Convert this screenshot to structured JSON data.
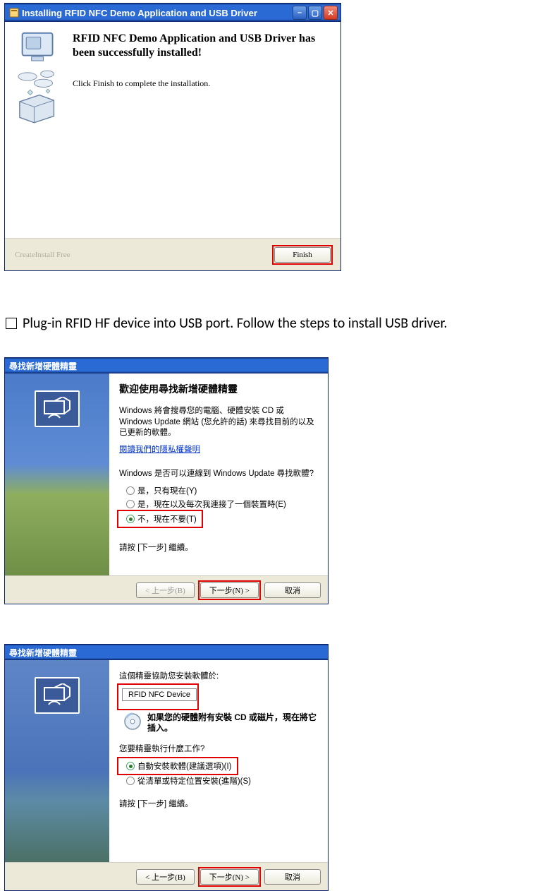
{
  "dialog1": {
    "title": "Installing RFID NFC Demo Application and USB Driver",
    "heading": "RFID NFC Demo Application and USB Driver has been successfully installed!",
    "subtext": "Click Finish to complete the installation.",
    "createinstall": "CreateInstall Free",
    "finish_btn": "Finish"
  },
  "instruction": {
    "text": "Plug-in RFID HF device into USB port. Follow the steps to install USB driver."
  },
  "wizard_common": {
    "title": "尋找新增硬體精靈",
    "back_btn": "< 上一步(B)",
    "next_btn": "下一步(N) >",
    "cancel_btn": "取消",
    "continue_text": "請按 [下一步] 繼續。"
  },
  "dialog2": {
    "heading": "歡迎使用尋找新增硬體精靈",
    "para1": "Windows 將會搜尋您的電腦、硬體安裝 CD 或 Windows Update 網站 (您允許的話) 來尋找目前的以及已更新的軟體。",
    "privacy_link": "閱讀我們的隱私權聲明",
    "question": "Windows 是否可以連線到 Windows Update 尋找軟體?",
    "opt_yes_now": "是，只有現在(Y)",
    "opt_yes_always": "是，現在以及每次我連接了一個裝置時(E)",
    "opt_no": "不，現在不要(T)"
  },
  "dialog3": {
    "intro": "這個精靈協助您安裝軟體於:",
    "device_name": "RFID NFC Device",
    "cd_note": "如果您的硬體附有安裝 CD 或磁片，現在將它插入。",
    "question": "您要精靈執行什麼工作?",
    "opt_auto": "自動安裝軟體(建議選項)(I)",
    "opt_manual": "從清單或特定位置安裝(進階)(S)"
  }
}
